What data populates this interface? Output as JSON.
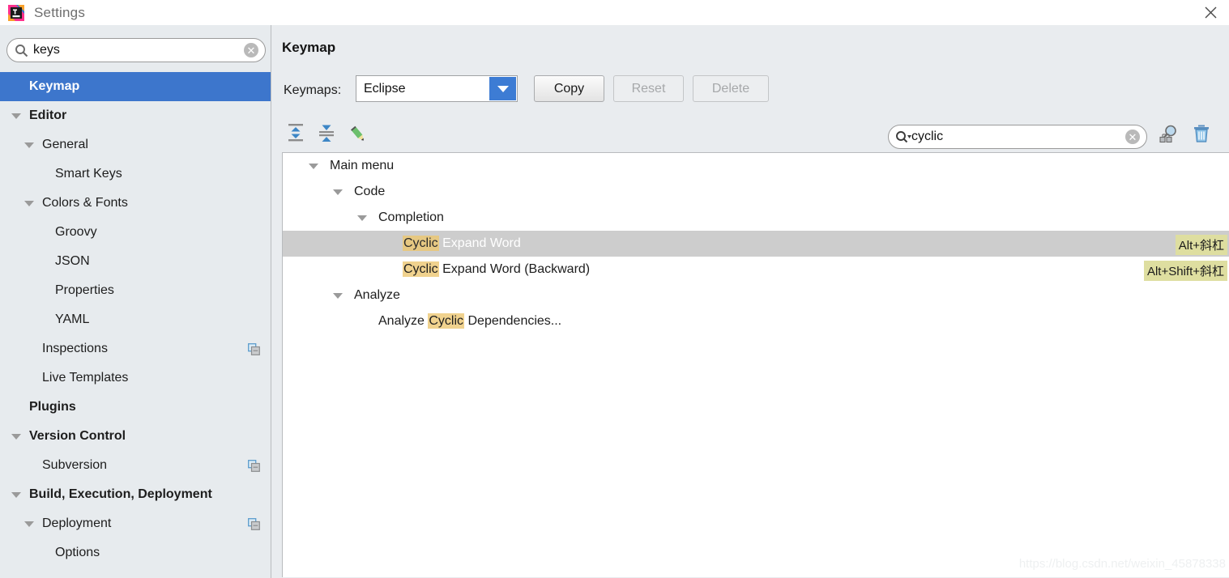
{
  "window": {
    "title": "Settings",
    "logo_icon": "intellij-idea-logo",
    "close_icon": "close-icon"
  },
  "sidebar": {
    "search": {
      "value": "keys",
      "placeholder": "",
      "icon": "search-icon",
      "clear_icon": "clear-icon"
    },
    "items": [
      {
        "label": "Keymap",
        "indent": 36,
        "bold": true,
        "selected": true,
        "arrow": null,
        "copy_icon": false
      },
      {
        "label": "Editor",
        "indent": 36,
        "bold": true,
        "selected": false,
        "arrow": 14,
        "copy_icon": false
      },
      {
        "label": "General",
        "indent": 52,
        "bold": false,
        "selected": false,
        "arrow": 30,
        "copy_icon": false
      },
      {
        "label": "Smart Keys",
        "indent": 68,
        "bold": false,
        "selected": false,
        "arrow": null,
        "copy_icon": false
      },
      {
        "label": "Colors & Fonts",
        "indent": 52,
        "bold": false,
        "selected": false,
        "arrow": 30,
        "copy_icon": false
      },
      {
        "label": "Groovy",
        "indent": 68,
        "bold": false,
        "selected": false,
        "arrow": null,
        "copy_icon": false
      },
      {
        "label": "JSON",
        "indent": 68,
        "bold": false,
        "selected": false,
        "arrow": null,
        "copy_icon": false
      },
      {
        "label": "Properties",
        "indent": 68,
        "bold": false,
        "selected": false,
        "arrow": null,
        "copy_icon": false
      },
      {
        "label": "YAML",
        "indent": 68,
        "bold": false,
        "selected": false,
        "arrow": null,
        "copy_icon": false
      },
      {
        "label": "Inspections",
        "indent": 52,
        "bold": false,
        "selected": false,
        "arrow": null,
        "copy_icon": true
      },
      {
        "label": "Live Templates",
        "indent": 52,
        "bold": false,
        "selected": false,
        "arrow": null,
        "copy_icon": false
      },
      {
        "label": "Plugins",
        "indent": 36,
        "bold": true,
        "selected": false,
        "arrow": null,
        "copy_icon": false
      },
      {
        "label": "Version Control",
        "indent": 36,
        "bold": true,
        "selected": false,
        "arrow": 14,
        "copy_icon": false
      },
      {
        "label": "Subversion",
        "indent": 52,
        "bold": false,
        "selected": false,
        "arrow": null,
        "copy_icon": true
      },
      {
        "label": "Build, Execution, Deployment",
        "indent": 36,
        "bold": true,
        "selected": false,
        "arrow": 14,
        "copy_icon": false
      },
      {
        "label": "Deployment",
        "indent": 52,
        "bold": false,
        "selected": false,
        "arrow": 30,
        "copy_icon": true
      },
      {
        "label": "Options",
        "indent": 68,
        "bold": false,
        "selected": false,
        "arrow": null,
        "copy_icon": false
      }
    ]
  },
  "main": {
    "title": "Keymap",
    "keymaps_label": "Keymaps:",
    "keymap_selected": "Eclipse",
    "keymap_options": [
      "Eclipse"
    ],
    "buttons": {
      "copy": "Copy",
      "reset": "Reset",
      "delete": "Delete"
    },
    "toolbar_icons": [
      "expand-all-icon",
      "collapse-all-icon",
      "edit-shortcut-icon"
    ],
    "filter_search": {
      "value": "cyclic",
      "placeholder": "",
      "icon": "search-dropdown-icon",
      "clear_icon": "clear-icon"
    },
    "right_icons": [
      "find-by-shortcut-icon",
      "reset-filter-trash-icon"
    ],
    "tree": [
      {
        "indent": 58,
        "arrow": 32,
        "selected": false,
        "parts": [
          {
            "t": "Main menu",
            "hl": false
          }
        ],
        "shortcut": null
      },
      {
        "indent": 88,
        "arrow": 62,
        "selected": false,
        "parts": [
          {
            "t": "Code",
            "hl": false
          }
        ],
        "shortcut": null
      },
      {
        "indent": 118,
        "arrow": 92,
        "selected": false,
        "parts": [
          {
            "t": "Completion",
            "hl": false
          }
        ],
        "shortcut": null
      },
      {
        "indent": 148,
        "arrow": null,
        "selected": true,
        "parts": [
          {
            "t": "Cyclic",
            "hl": true
          },
          {
            "t": " Expand Word",
            "hl": false
          }
        ],
        "shortcut": "Alt+斜杠"
      },
      {
        "indent": 148,
        "arrow": null,
        "selected": false,
        "parts": [
          {
            "t": "Cyclic",
            "hl": true
          },
          {
            "t": " Expand Word (Backward)",
            "hl": false
          }
        ],
        "shortcut": "Alt+Shift+斜杠"
      },
      {
        "indent": 88,
        "arrow": 62,
        "selected": false,
        "parts": [
          {
            "t": "Analyze",
            "hl": false
          }
        ],
        "shortcut": null
      },
      {
        "indent": 118,
        "arrow": null,
        "selected": false,
        "parts": [
          {
            "t": "Analyze ",
            "hl": false
          },
          {
            "t": "Cyclic",
            "hl": true
          },
          {
            "t": " Dependencies...",
            "hl": false
          }
        ],
        "shortcut": null
      }
    ],
    "watermark": "https://blog.csdn.net/weixin_45878338"
  },
  "colors": {
    "selection_blue": "#3d76cc",
    "tree_selection_gray": "#cdcdcd",
    "match_highlight": "#f0d28e",
    "shortcut_highlight": "#dedea0",
    "combo_arrow_blue": "#3d7cd4",
    "panel_bg": "#e9ecef"
  }
}
